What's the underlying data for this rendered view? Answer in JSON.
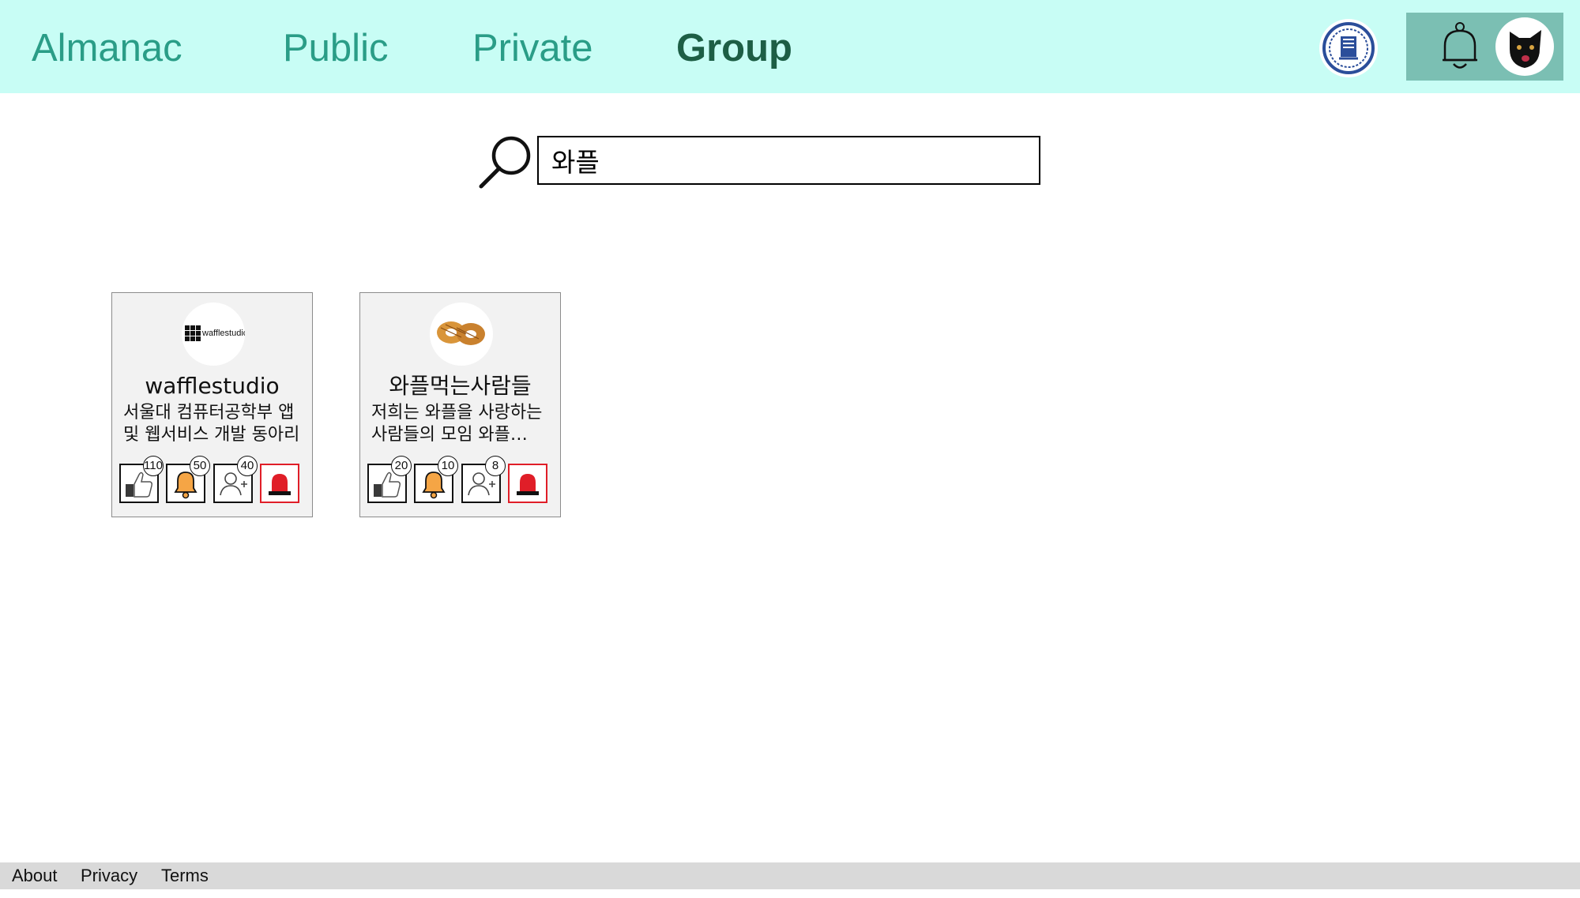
{
  "nav": {
    "brand": "Almanac",
    "tabs": [
      {
        "label": "Public",
        "active": false
      },
      {
        "label": "Private",
        "active": false
      },
      {
        "label": "Group",
        "active": true
      }
    ]
  },
  "colors": {
    "topbar_bg": "#c8fdf5",
    "nav_text": "#2a9d87",
    "nav_active_text": "#1d5e45",
    "user_panel_bg": "#7bbfb3",
    "report_red": "#e01e28",
    "footer_bg": "#d9d9d9"
  },
  "header_icons": {
    "school_logo": "snu-emblem-icon",
    "notifications": "bell-icon",
    "avatar": "black-dog-avatar"
  },
  "search": {
    "icon": "search-icon",
    "value": "와플"
  },
  "groups": [
    {
      "name": "wafflestudio",
      "description": "서울대 컴퓨터공학부 앱 및 웹서비스 개발 동아리",
      "logo": "wafflestudio-logo",
      "logo_text": "wafflestudio",
      "likes": "110",
      "alarms": "50",
      "members": "40"
    },
    {
      "name": "와플먹는사람들",
      "description": "저희는 와플을 사랑하는 사람들의 모임 와플 좋아하시는 분들 환영합니다",
      "logo": "waffle-pastry-logo",
      "likes": "20",
      "alarms": "10",
      "members": "8"
    }
  ],
  "footer": {
    "links": [
      "About",
      "Privacy",
      "Terms"
    ]
  }
}
